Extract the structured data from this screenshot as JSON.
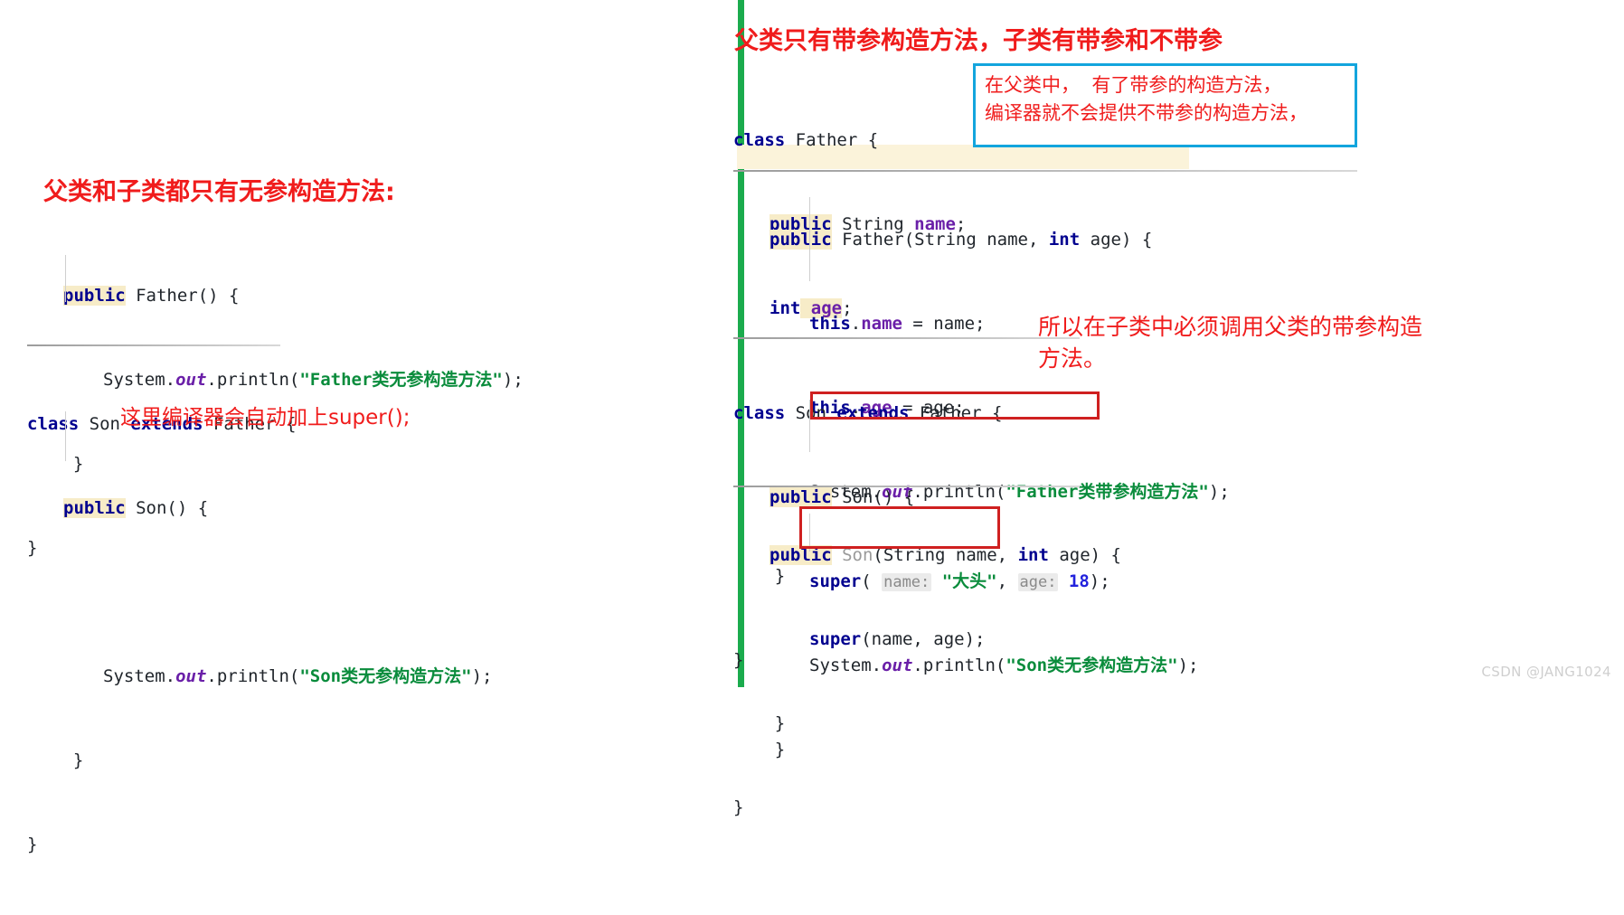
{
  "watermark": "CSDN @JANG1024",
  "divider_color": "#1bab4d",
  "colors": {
    "annotation_red": "#f01c1c",
    "box_blue": "#13a5dd",
    "box_red": "#cf2020",
    "keyword": "#00008f",
    "string": "#0a8c3c",
    "field": "#6a1fa8",
    "number": "#2222dd",
    "keyword_highlight_bg": "#f7ecc8"
  },
  "left": {
    "heading": "父类和子类都只有无参构造方法:",
    "inline_note": "这里编译器会自动加上super();",
    "father_code": {
      "l1_kw": "public",
      "l1_rest": " Father() {",
      "l2_indent": "    ",
      "l2_sys": "System.",
      "l2_out": "out",
      "l2_call": ".println(",
      "l2_str": "\"Father类无参构造方法\"",
      "l2_tail": ");",
      "l3": "  }",
      "l4": "}"
    },
    "son_code": {
      "c1_kw": "class",
      "c1_name": " Son ",
      "c1_kw2": "extends",
      "c1_rest": " Father {",
      "c2_kw": "public",
      "c2_rest": " Son() {",
      "c3_sys": "System.",
      "c3_out": "out",
      "c3_call": ".println(",
      "c3_str": "\"Son类无参构造方法\"",
      "c3_tail": ");",
      "c4": "  }",
      "c5": "}"
    }
  },
  "right": {
    "heading": "父类只有带参构造方法，子类有带参和不带参",
    "blue_box": {
      "line1": "在父类中，  有了带参的构造方法，",
      "line2": "编译器就不会提供不带参的构造方法，"
    },
    "red_note": {
      "line1": "所以在子类中必须调用父类的带参构造",
      "line2": "方法。"
    },
    "father_code": {
      "f1_kw": "class",
      "f1_rest": " Father {",
      "f2_kw": "public",
      "f2_mid": " String ",
      "f2_fld": "name",
      "f2_tail": ";",
      "f3_kw": "int",
      "f3_fld": " age",
      "f3_tail": ";",
      "f4_kw": "public",
      "f4_rest": " Father(String name, ",
      "f4_kw2": "int",
      "f4_rest2": " age) {",
      "f5_kw": "this",
      "f5_dot": ".",
      "f5_fld": "name",
      "f5_rest": " = name;",
      "f6_kw": "this",
      "f6_dot": ".",
      "f6_fld": "age",
      "f6_rest": " = age;",
      "f7_sys": "System.",
      "f7_out": "out",
      "f7_call": ".println(",
      "f7_str": "\"Father类带参构造方法\"",
      "f7_tail": ");",
      "f8": "    }",
      "f9": "}"
    },
    "son_code": {
      "s1_kw": "class",
      "s1_name": " Son ",
      "s1_kw2": "extends",
      "s1_rest": " Father {",
      "s2_kw": "public",
      "s2_rest": " Son() {",
      "s3_kw": "super",
      "s3_open": "( ",
      "s3_hint1": "name:",
      "s3_str": " \"大头\"",
      "s3_comma": ", ",
      "s3_hint2": "age:",
      "s3_num": " 18",
      "s3_tail": ");",
      "s4_sys": "System.",
      "s4_out": "out",
      "s4_call": ".println(",
      "s4_str": "\"Son类无参构造方法\"",
      "s4_tail": ");",
      "s5": "    }",
      "s6_kw": "public",
      "s6_gray": " Son",
      "s6_rest": "(String name, ",
      "s6_kw2": "int",
      "s6_rest2": " age) {",
      "s7_kw": "super",
      "s7_rest": "(name, age);",
      "s8": "    }",
      "s9": "}"
    }
  }
}
